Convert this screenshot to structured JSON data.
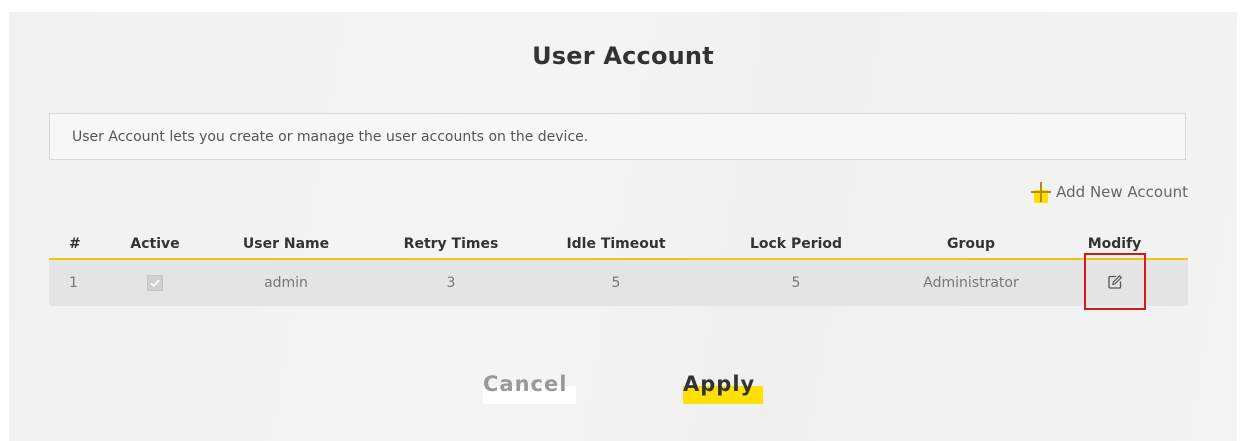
{
  "page": {
    "title": "User Account",
    "description": "User Account lets you create or manage the user accounts on the device.",
    "add_account_label": "Add New Account"
  },
  "table": {
    "headers": [
      "#",
      "Active",
      "User Name",
      "Retry Times",
      "Idle Timeout",
      "Lock Period",
      "Group",
      "Modify"
    ],
    "rows": [
      {
        "index": "1",
        "active": true,
        "user_name": "admin",
        "retry_times": "3",
        "idle_timeout": "5",
        "lock_period": "5",
        "group": "Administrator",
        "modify_icon": "edit-icon"
      }
    ]
  },
  "buttons": {
    "cancel": "Cancel",
    "apply": "Apply"
  },
  "colors": {
    "accent_yellow": "#ffe000",
    "header_rule": "#f0c419",
    "highlight_red": "#d11a1a"
  }
}
